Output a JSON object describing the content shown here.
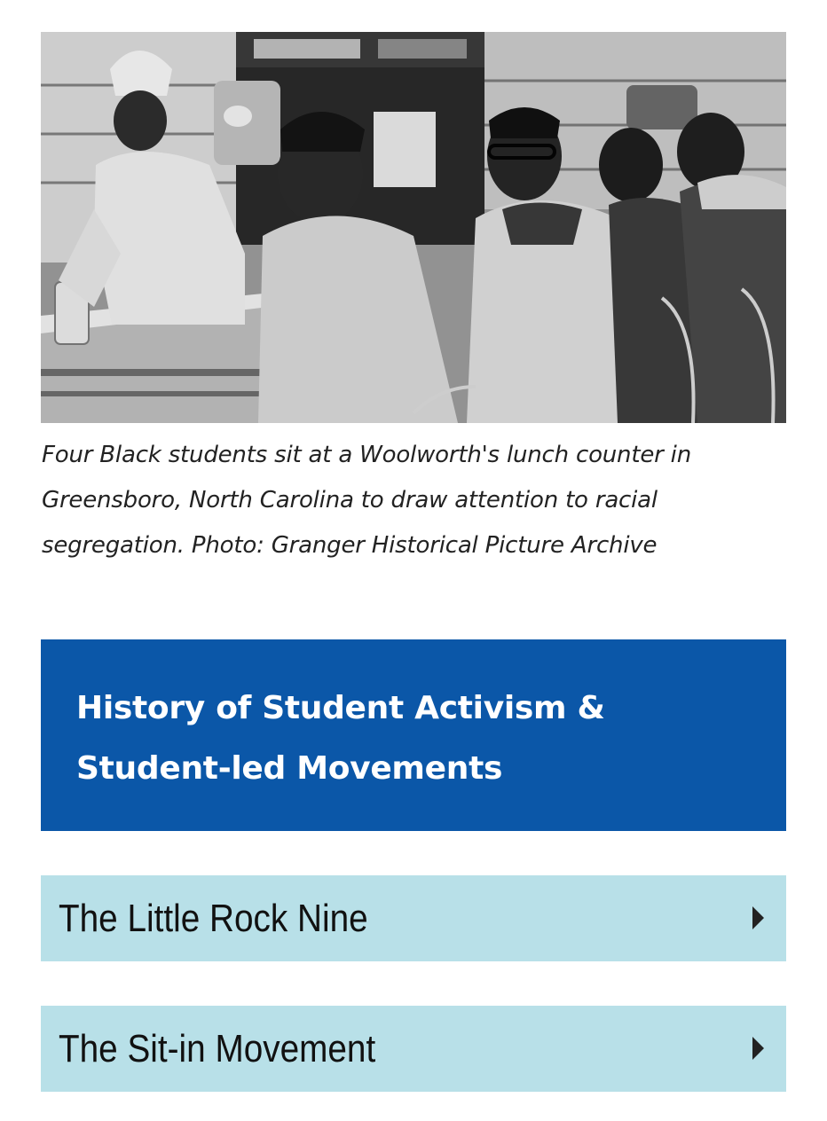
{
  "figure": {
    "image_alt": "Four Black students seated at a lunch counter",
    "caption": "Four Black students sit at a Woolworth's lunch counter in Greensboro, North Carolina to draw attention to racial segregation. Photo: Granger Historical Picture Archive"
  },
  "section": {
    "title": "History of Student Activism & Student-led Movements"
  },
  "accordion": {
    "items": [
      {
        "label": "The Little Rock Nine",
        "icon": "caret-right-icon",
        "expanded": false
      },
      {
        "label": "The Sit-in Movement",
        "icon": "caret-right-icon",
        "expanded": false
      }
    ]
  },
  "colors": {
    "header_bg": "#0b57a8",
    "accordion_bg": "#b8e0e8",
    "caption_text": "#222222"
  }
}
